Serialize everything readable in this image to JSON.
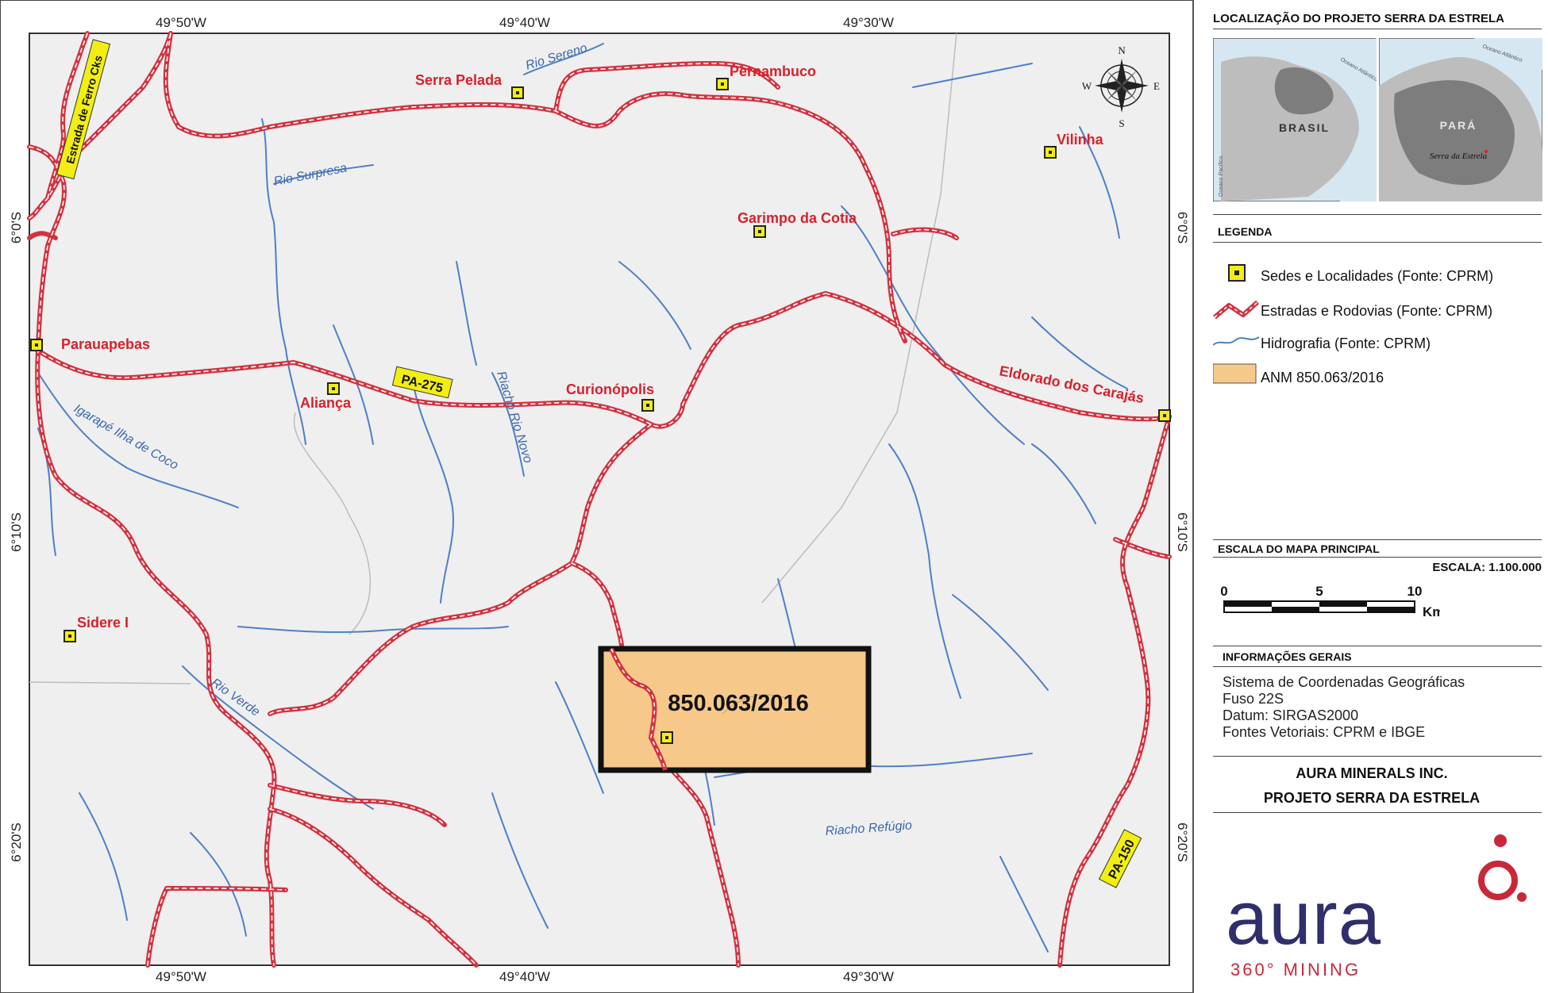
{
  "map": {
    "coords_top": [
      "49°50'W",
      "49°40'W",
      "49°30'W"
    ],
    "coords_bottom": [
      "49°50'W",
      "49°40'W",
      "49°30'W"
    ],
    "coords_left": [
      "6°0'S",
      "6°10'S",
      "6°20'S"
    ],
    "coords_right": [
      "6°0'S",
      "6°10'S",
      "6°20'S"
    ],
    "compass": {
      "n": "N",
      "s": "S",
      "e": "E",
      "w": "W"
    },
    "places": [
      {
        "name": "Serra Pelada"
      },
      {
        "name": "Pernambuco"
      },
      {
        "name": "Vilinha"
      },
      {
        "name": "Garimpo da Cotia"
      },
      {
        "name": "Parauapebas"
      },
      {
        "name": "Aliança"
      },
      {
        "name": "Curionópolis"
      },
      {
        "name": "Eldorado dos Carajás"
      },
      {
        "name": "Sidere I"
      }
    ],
    "rivers": [
      "Rio Sereno",
      "Rio Surpresa",
      "Riacho Rio Novo",
      "Igarapé Ilha de Coco",
      "Rio Verde",
      "Riacho Refúgio"
    ],
    "roads": [
      "PA-275",
      "PA-150",
      "Estrada de Ferro Cks"
    ],
    "anm_label": "850.063/2016"
  },
  "panel": {
    "location_title": "LOCALIZAÇÃO DO PROJETO SERRA DA ESTRELA",
    "inset": {
      "brasil": "BRASIL",
      "para": "PARÁ",
      "serra": "Serra da Estrela",
      "oceano_atl": "Oceano Atlântico",
      "oceano_pac": "Oceano Pacífico",
      "oceano_atl2": "Oceano Atlântico"
    },
    "legend_title": "LEGENDA",
    "legend": [
      "Sedes e Localidades (Fonte: CPRM)",
      "Estradas e Rodovias (Fonte: CPRM)",
      "Hidrografia (Fonte: CPRM)",
      "ANM 850.063/2016"
    ],
    "scale_title": "ESCALA DO MAPA PRINCIPAL",
    "scale_text": "ESCALA: 1.100.000",
    "scale_ticks": [
      "0",
      "5",
      "10"
    ],
    "scale_unit": "Km",
    "info_title": "INFORMAÇÕES GERAIS",
    "info_lines": [
      "Sistema de Coordenadas Geográficas",
      "Fuso 22S",
      "Datum: SIRGAS2000",
      "Fontes Vetoriais: CPRM e IBGE"
    ],
    "company": "AURA MINERALS INC.",
    "project": "PROJETO SERRA DA ESTRELA",
    "logo_word": "aura",
    "logo_sub": "360° MINING"
  },
  "colors": {
    "road": "#d3323f",
    "river": "#4d7fc7",
    "map_bg": "#efefef",
    "anm_fill": "#f6c98a",
    "marker": "#f2ee12",
    "place_text": "#d8202c",
    "logo_blue": "#2e2f6b",
    "logo_red": "#c8283a"
  }
}
